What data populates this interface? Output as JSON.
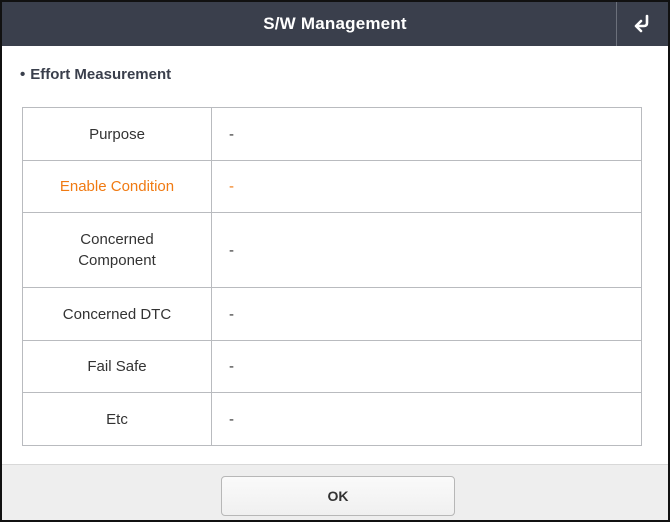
{
  "window": {
    "title": "S/W Management",
    "back_icon": "return-arrow-icon"
  },
  "section": {
    "bullet": "•",
    "title": "Effort Measurement"
  },
  "table": {
    "rows": [
      {
        "label": "Purpose",
        "value": "-",
        "highlighted": false
      },
      {
        "label": "Enable Condition",
        "value": "-",
        "highlighted": true
      },
      {
        "label": "Concerned Component",
        "label_lines": [
          "Concerned",
          "Component"
        ],
        "value": "-",
        "highlighted": false
      },
      {
        "label": "Concerned DTC",
        "value": "-",
        "highlighted": false
      },
      {
        "label": "Fail Safe",
        "value": "-",
        "highlighted": false
      },
      {
        "label": "Etc",
        "value": "-",
        "highlighted": false
      }
    ]
  },
  "footer": {
    "ok_label": "OK"
  },
  "colors": {
    "titlebar": "#3a3f4c",
    "highlight": "#f07a12",
    "footer": "#eeeeee"
  }
}
